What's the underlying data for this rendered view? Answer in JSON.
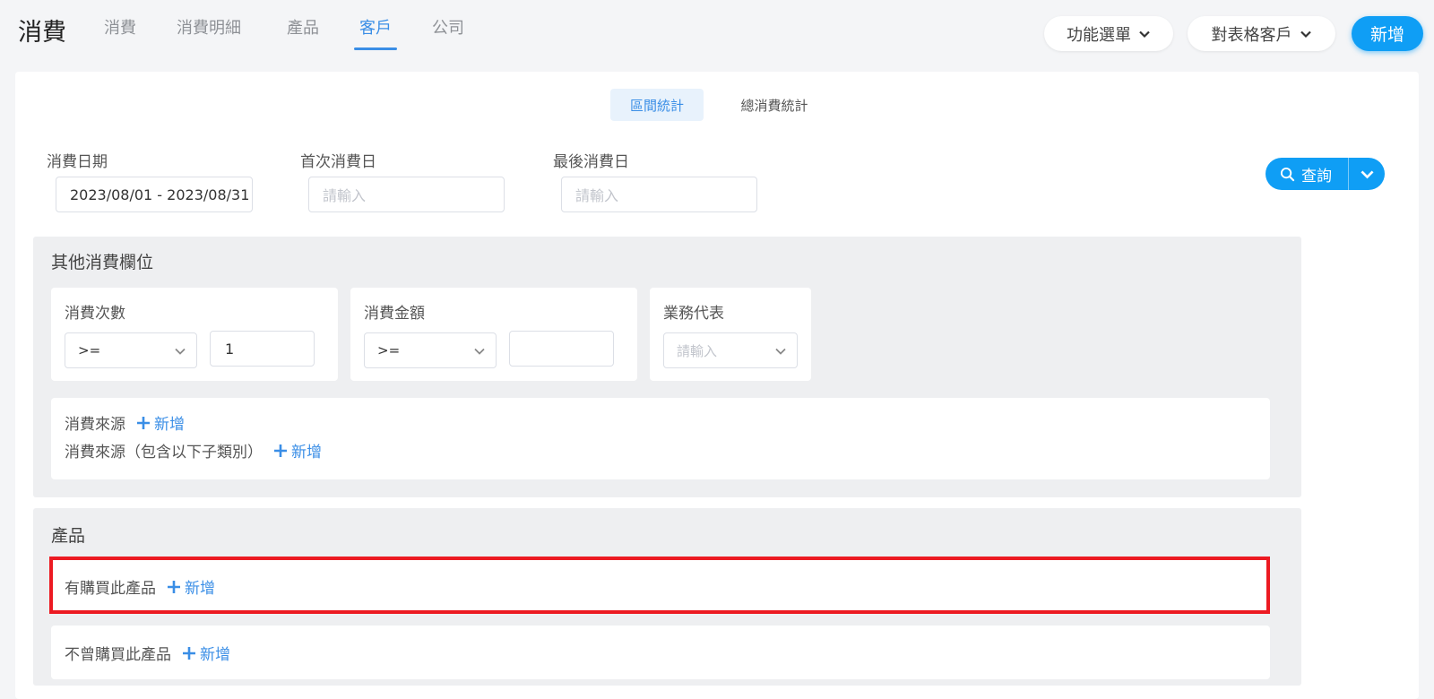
{
  "header": {
    "brand": "消費",
    "tabs": [
      "消費",
      "消費明細",
      "產品",
      "客戶",
      "公司"
    ],
    "active_tab": "客戶",
    "function_menu": "功能選單",
    "table_customer_menu": "對表格客戶",
    "new_button": "新增"
  },
  "subtabs": {
    "range_stats": "區間統計",
    "total_stats": "總消費統計",
    "active": "區間統計"
  },
  "filters": {
    "consume_date_label": "消費日期",
    "consume_date_value": "2023/08/01 - 2023/08/31",
    "first_date_label": "首次消費日",
    "first_date_placeholder": "請輸入",
    "last_date_label": "最後消費日",
    "last_date_placeholder": "請輸入",
    "search_label": "查詢"
  },
  "other_fields": {
    "title": "其他消費欄位",
    "count": {
      "label": "消費次數",
      "operator": ">=",
      "value": "1"
    },
    "amount": {
      "label": "消費金額",
      "operator": ">=",
      "value": ""
    },
    "rep": {
      "label": "業務代表",
      "placeholder": "請輸入"
    },
    "source_label": "消費來源",
    "source_sub_label": "消費來源（包含以下子類別）",
    "add_label": "新增"
  },
  "products": {
    "title": "產品",
    "bought_label": "有購買此產品",
    "not_bought_label": "不曾購買此產品",
    "add_label": "新增"
  },
  "colors": {
    "accent": "#3a8ee6",
    "button": "#0f9ef5",
    "highlight": "#ec1a22"
  }
}
